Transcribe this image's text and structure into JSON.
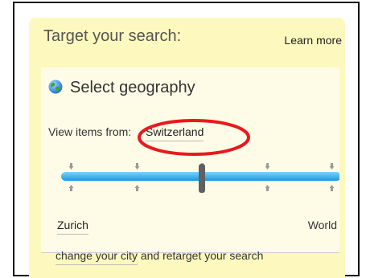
{
  "panel": {
    "title": "Target your search:",
    "learn_more": "Learn more"
  },
  "geography": {
    "title": "Select geography",
    "icon": "globe-icon",
    "view_items_label": "View items from:",
    "selected_location": "Switzerland",
    "slider": {
      "stops": 7,
      "selected_stop": 4,
      "min_label": "Zurich",
      "max_label": "World"
    },
    "change_city_link": "change your city",
    "retarget_text": " and retarget your search"
  },
  "colors": {
    "panel_background": "#fdf9be",
    "slider_track": "#2aa9ea",
    "highlight_circle": "#e8191e"
  }
}
